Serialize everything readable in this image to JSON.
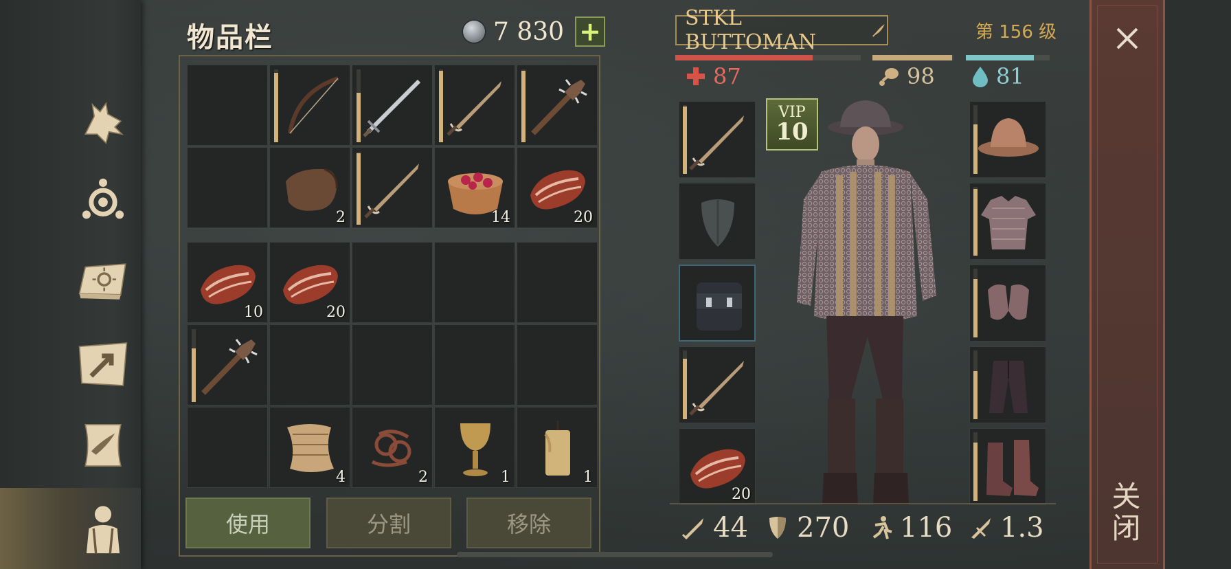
{
  "inventory": {
    "title": "物品栏",
    "currency": {
      "label": "7 830",
      "icon": "silver-coin-icon"
    },
    "top_grid": [
      {
        "item": null
      },
      {
        "item": "bow-icon",
        "durability": 0.95
      },
      {
        "item": "longsword-icon",
        "durability": 0.68
      },
      {
        "item": "short-sword-icon",
        "durability": 0.98
      },
      {
        "item": "spiked-club-icon",
        "durability": 0.98
      },
      {
        "item": null
      },
      {
        "item": "leather-hide-icon",
        "count": "2"
      },
      {
        "item": "short-sword-icon",
        "durability": 0.98
      },
      {
        "item": "berry-bowl-icon",
        "count": "14"
      },
      {
        "item": "raw-meat-icon",
        "count": "20"
      }
    ],
    "bottom_grid": [
      {
        "item": "raw-meat-icon",
        "count": "10"
      },
      {
        "item": "raw-meat-icon",
        "count": "20"
      },
      {
        "item": null
      },
      {
        "item": null
      },
      {
        "item": null
      },
      {
        "item": "spiked-club-icon",
        "durability": 0.74
      },
      {
        "item": null
      },
      {
        "item": null
      },
      {
        "item": null
      },
      {
        "item": null
      },
      {
        "item": null
      },
      {
        "item": "cloth-icon",
        "count": "4"
      },
      {
        "item": "rope-icon",
        "count": "2"
      },
      {
        "item": "goblet-icon",
        "count": "1"
      },
      {
        "item": "candle-icon",
        "count": "1"
      }
    ],
    "buttons": {
      "use": "使用",
      "split": "分割",
      "remove": "移除"
    }
  },
  "character": {
    "name": "STKL BUTTOMAN",
    "level": "第 156 级",
    "vip": {
      "line1": "VIP",
      "line2": "10"
    },
    "stats": {
      "health": {
        "value": "87",
        "fill": 0.74,
        "color": "#d0534a"
      },
      "food": {
        "value": "98",
        "fill": 0.98,
        "color": "#c7aa7c"
      },
      "water": {
        "value": "81",
        "fill": 0.81,
        "color": "#7fc6c9"
      }
    },
    "left_slots": [
      {
        "item": "short-sword-icon",
        "durability": 0.98
      },
      {
        "item": "shield-silhouette-icon"
      },
      {
        "item": "backpack-icon",
        "selected": true
      },
      {
        "item": "short-sword-icon",
        "durability": 0.88
      },
      {
        "item": "raw-meat-icon",
        "count": "20"
      }
    ],
    "right_slots": [
      {
        "item": "kettle-helmet-icon",
        "durability": 0.72
      },
      {
        "item": "chainmail-shirt-icon",
        "durability": 0.97
      },
      {
        "item": "chain-gloves-icon",
        "durability": 0.85
      },
      {
        "item": "trousers-icon",
        "durability": 0.7
      },
      {
        "item": "boots-icon",
        "durability": 0.85
      }
    ],
    "bottom_stats": [
      {
        "icon": "attack-icon",
        "value": "44"
      },
      {
        "icon": "armor-icon",
        "value": "270"
      },
      {
        "icon": "speed-icon",
        "value": "116"
      },
      {
        "icon": "weight-icon",
        "value": "1.3"
      }
    ]
  },
  "close_panel": {
    "label": "关闭"
  },
  "colors": {
    "accent": "#d2b27b",
    "frame": "#6b6148",
    "close_panel": "#5a3a33"
  }
}
